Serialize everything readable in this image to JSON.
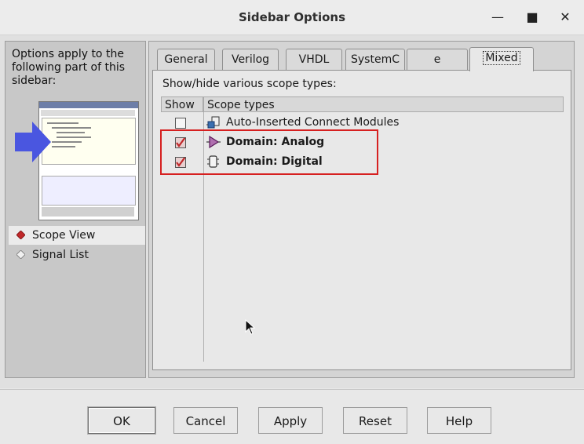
{
  "window": {
    "title": "Sidebar Options",
    "controls": [
      "minimize-icon",
      "maximize-icon",
      "close-icon"
    ],
    "minimize_glyph": "—",
    "maximize_glyph": "■",
    "close_glyph": "✕"
  },
  "sidebar": {
    "intro": "Options apply to the following part of this sidebar:",
    "items": [
      {
        "label": "Scope View",
        "selected": true
      },
      {
        "label": "Signal List",
        "selected": false
      }
    ]
  },
  "tabs": [
    {
      "label": "General",
      "active": false
    },
    {
      "label": "Verilog",
      "active": false
    },
    {
      "label": "VHDL",
      "active": false
    },
    {
      "label": "SystemC",
      "active": false
    },
    {
      "label": "e",
      "active": false
    },
    {
      "label": "Mixed",
      "active": true
    }
  ],
  "mixed": {
    "hint": "Show/hide various scope types:",
    "columns": [
      "Show",
      "Scope types"
    ],
    "rows": [
      {
        "label": "Auto-Inserted Connect Modules",
        "checked": false,
        "bold": false,
        "icon": "connect-module-icon"
      },
      {
        "label": "Domain:  Analog",
        "checked": true,
        "bold": true,
        "icon": "analog-domain-icon"
      },
      {
        "label": "Domain:  Digital",
        "checked": true,
        "bold": true,
        "icon": "digital-domain-icon"
      }
    ]
  },
  "buttons": {
    "ok": "OK",
    "cancel": "Cancel",
    "apply": "Apply",
    "reset": "Reset",
    "help": "Help"
  },
  "colors": {
    "highlight_box": "#d62020",
    "check_mark": "#c0282a",
    "analog_icon": "#7a1f7a",
    "selection_diamond": "#c0282a",
    "arrow": "#4a56e0"
  }
}
